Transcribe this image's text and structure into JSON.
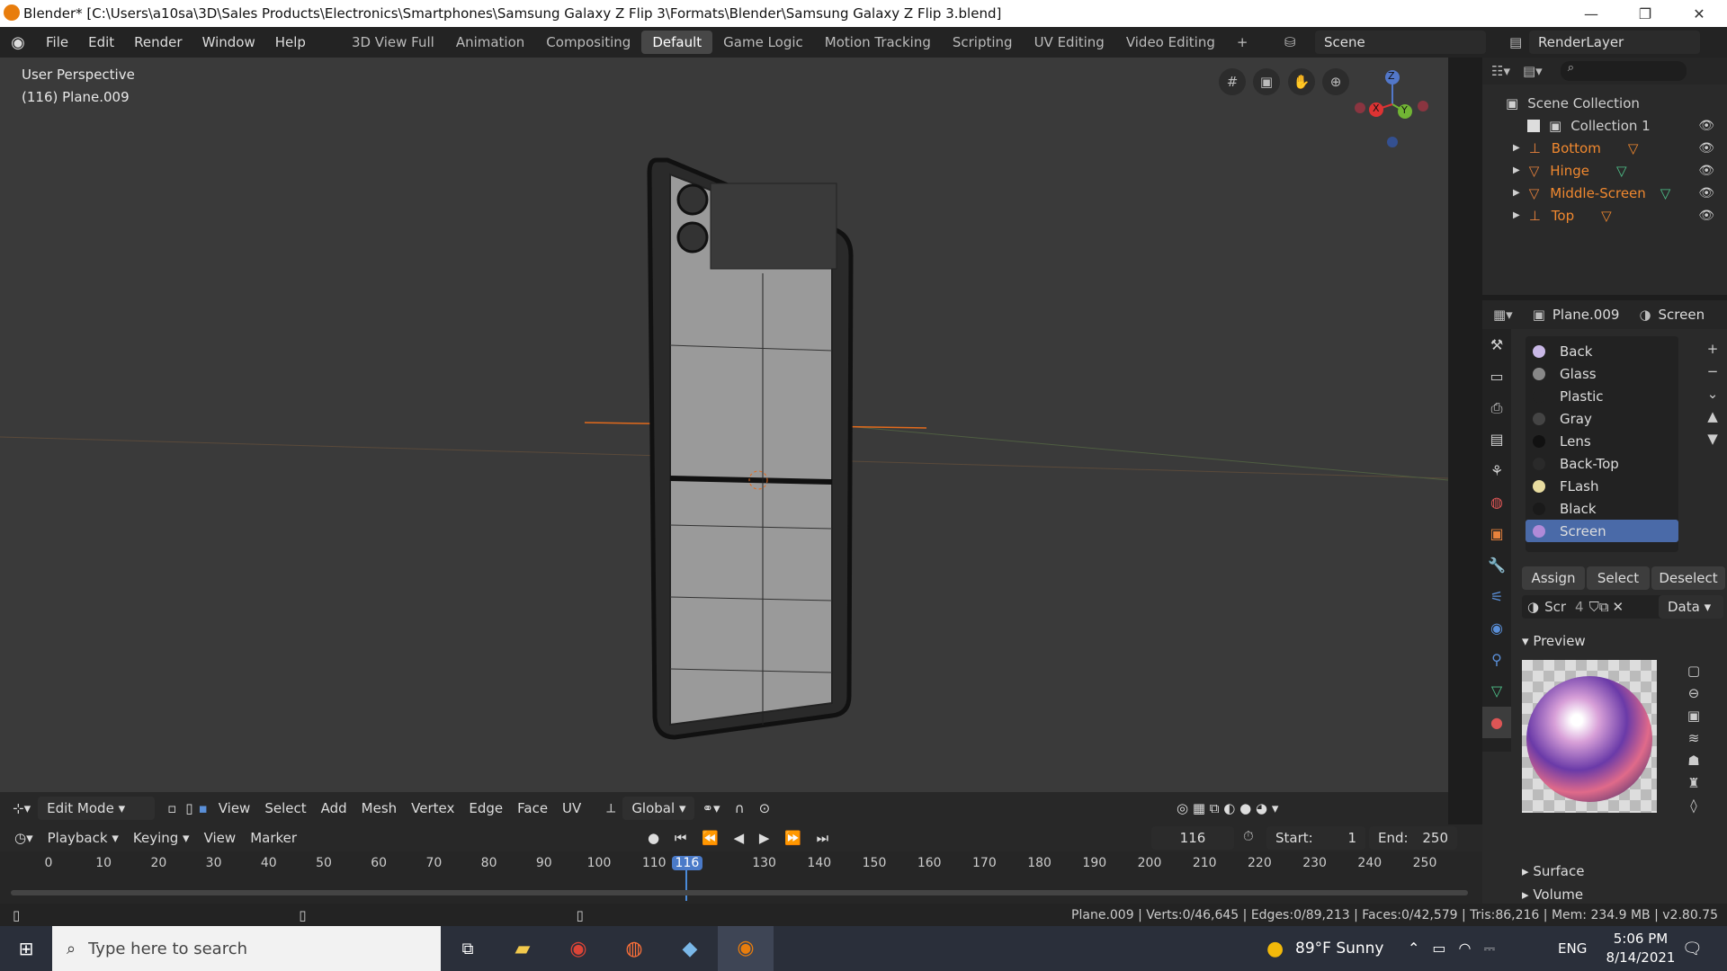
{
  "title": "Blender* [C:\\Users\\a10sa\\3D\\Sales Products\\Electronics\\Smartphones\\Samsung Galaxy Z Flip 3\\Formats\\Blender\\Samsung Galaxy Z Flip 3.blend]",
  "window_controls": {
    "minimize": "—",
    "maximize": "❐",
    "close": "✕"
  },
  "menus": [
    "File",
    "Edit",
    "Render",
    "Window",
    "Help"
  ],
  "workspaces": [
    "3D View Full",
    "Animation",
    "Compositing",
    "Default",
    "Game Logic",
    "Motion Tracking",
    "Scripting",
    "UV Editing",
    "Video Editing"
  ],
  "active_workspace": "Default",
  "scene": "Scene",
  "render_layer": "RenderLayer",
  "viewport": {
    "perspective": "User Perspective",
    "object": "(116) Plane.009",
    "gizmo": {
      "z": "Z",
      "y": "Y",
      "x": "X"
    }
  },
  "toolbar": {
    "mode": "Edit Mode",
    "menus": [
      "View",
      "Select",
      "Add",
      "Mesh",
      "Vertex",
      "Edge",
      "Face",
      "UV"
    ],
    "transform": "Global"
  },
  "outliner": {
    "scene_collection": "Scene Collection",
    "collection": "Collection 1",
    "objects": [
      "Bottom",
      "Hinge",
      "Middle-Screen",
      "Top"
    ]
  },
  "properties": {
    "object": "Plane.009",
    "material_name": "Screen",
    "materials": [
      {
        "name": "Back",
        "color": "#c9b8e6"
      },
      {
        "name": "Glass",
        "color": "#888888"
      },
      {
        "name": "Plastic",
        "color": "#222222"
      },
      {
        "name": "Gray",
        "color": "#444444"
      },
      {
        "name": "Lens",
        "color": "#111111"
      },
      {
        "name": "Back-Top",
        "color": "#2a2a2a"
      },
      {
        "name": "FLash",
        "color": "#e8dca0"
      },
      {
        "name": "Black",
        "color": "#1a1a1a"
      },
      {
        "name": "Screen",
        "color": "#b08ad8"
      }
    ],
    "selected_material": "Screen",
    "assign": "Assign",
    "select": "Select",
    "deselect": "Deselect",
    "mat_short": "Scr",
    "mat_users": "4",
    "link": "Data",
    "preview": "Preview",
    "surface": "Surface",
    "volume": "Volume"
  },
  "timeline": {
    "menus": [
      "Playback",
      "Keying",
      "View",
      "Marker"
    ],
    "current_frame": "116",
    "start_label": "Start:",
    "start": "1",
    "end_label": "End:",
    "end": "250",
    "ticks": [
      "0",
      "10",
      "20",
      "30",
      "40",
      "50",
      "60",
      "70",
      "80",
      "90",
      "100",
      "110",
      "116",
      "130",
      "140",
      "150",
      "160",
      "170",
      "180",
      "190",
      "200",
      "210",
      "220",
      "230",
      "240",
      "250"
    ]
  },
  "status": "Plane.009 | Verts:0/46,645 | Edges:0/89,213 | Faces:0/42,579 | Tris:86,216 | Mem: 234.9 MB | v2.80.75",
  "taskbar": {
    "search_placeholder": "Type here to search",
    "weather": "89°F  Sunny",
    "lang": "ENG",
    "time": "5:06 PM",
    "date": "8/14/2021"
  }
}
